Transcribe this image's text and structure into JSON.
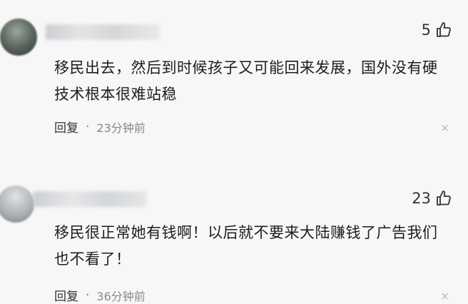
{
  "comments": [
    {
      "likes": "5",
      "text": "移民出去，然后到时候孩子又可能回来发展，国外没有硬技术根本很难站稳",
      "reply_label": "回复",
      "separator": "·",
      "time": "23分钟前",
      "close_glyph": "×"
    },
    {
      "likes": "23",
      "text": "移民很正常她有钱啊！以后就不要来大陆赚钱了广告我们也不看了！",
      "reply_label": "回复",
      "separator": "·",
      "time": "36分钟前",
      "close_glyph": "×"
    }
  ],
  "icons": {
    "like": "thumbs-up-icon",
    "avatar": "avatar",
    "close": "close-icon"
  },
  "colors": {
    "background": "#f7f7f8",
    "text": "#1d1d1d",
    "muted": "#888888"
  }
}
